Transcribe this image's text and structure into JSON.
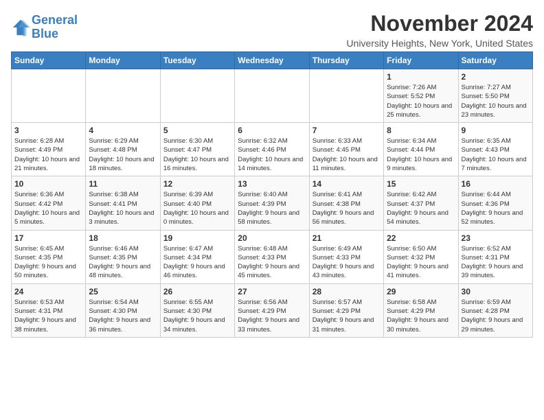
{
  "logo": {
    "line1": "General",
    "line2": "Blue"
  },
  "title": "November 2024",
  "subtitle": "University Heights, New York, United States",
  "days_header": [
    "Sunday",
    "Monday",
    "Tuesday",
    "Wednesday",
    "Thursday",
    "Friday",
    "Saturday"
  ],
  "weeks": [
    [
      {
        "day": "",
        "info": ""
      },
      {
        "day": "",
        "info": ""
      },
      {
        "day": "",
        "info": ""
      },
      {
        "day": "",
        "info": ""
      },
      {
        "day": "",
        "info": ""
      },
      {
        "day": "1",
        "info": "Sunrise: 7:26 AM\nSunset: 5:52 PM\nDaylight: 10 hours and 25 minutes."
      },
      {
        "day": "2",
        "info": "Sunrise: 7:27 AM\nSunset: 5:50 PM\nDaylight: 10 hours and 23 minutes."
      }
    ],
    [
      {
        "day": "3",
        "info": "Sunrise: 6:28 AM\nSunset: 4:49 PM\nDaylight: 10 hours and 21 minutes."
      },
      {
        "day": "4",
        "info": "Sunrise: 6:29 AM\nSunset: 4:48 PM\nDaylight: 10 hours and 18 minutes."
      },
      {
        "day": "5",
        "info": "Sunrise: 6:30 AM\nSunset: 4:47 PM\nDaylight: 10 hours and 16 minutes."
      },
      {
        "day": "6",
        "info": "Sunrise: 6:32 AM\nSunset: 4:46 PM\nDaylight: 10 hours and 14 minutes."
      },
      {
        "day": "7",
        "info": "Sunrise: 6:33 AM\nSunset: 4:45 PM\nDaylight: 10 hours and 11 minutes."
      },
      {
        "day": "8",
        "info": "Sunrise: 6:34 AM\nSunset: 4:44 PM\nDaylight: 10 hours and 9 minutes."
      },
      {
        "day": "9",
        "info": "Sunrise: 6:35 AM\nSunset: 4:43 PM\nDaylight: 10 hours and 7 minutes."
      }
    ],
    [
      {
        "day": "10",
        "info": "Sunrise: 6:36 AM\nSunset: 4:42 PM\nDaylight: 10 hours and 5 minutes."
      },
      {
        "day": "11",
        "info": "Sunrise: 6:38 AM\nSunset: 4:41 PM\nDaylight: 10 hours and 3 minutes."
      },
      {
        "day": "12",
        "info": "Sunrise: 6:39 AM\nSunset: 4:40 PM\nDaylight: 10 hours and 0 minutes."
      },
      {
        "day": "13",
        "info": "Sunrise: 6:40 AM\nSunset: 4:39 PM\nDaylight: 9 hours and 58 minutes."
      },
      {
        "day": "14",
        "info": "Sunrise: 6:41 AM\nSunset: 4:38 PM\nDaylight: 9 hours and 56 minutes."
      },
      {
        "day": "15",
        "info": "Sunrise: 6:42 AM\nSunset: 4:37 PM\nDaylight: 9 hours and 54 minutes."
      },
      {
        "day": "16",
        "info": "Sunrise: 6:44 AM\nSunset: 4:36 PM\nDaylight: 9 hours and 52 minutes."
      }
    ],
    [
      {
        "day": "17",
        "info": "Sunrise: 6:45 AM\nSunset: 4:35 PM\nDaylight: 9 hours and 50 minutes."
      },
      {
        "day": "18",
        "info": "Sunrise: 6:46 AM\nSunset: 4:35 PM\nDaylight: 9 hours and 48 minutes."
      },
      {
        "day": "19",
        "info": "Sunrise: 6:47 AM\nSunset: 4:34 PM\nDaylight: 9 hours and 46 minutes."
      },
      {
        "day": "20",
        "info": "Sunrise: 6:48 AM\nSunset: 4:33 PM\nDaylight: 9 hours and 45 minutes."
      },
      {
        "day": "21",
        "info": "Sunrise: 6:49 AM\nSunset: 4:33 PM\nDaylight: 9 hours and 43 minutes."
      },
      {
        "day": "22",
        "info": "Sunrise: 6:50 AM\nSunset: 4:32 PM\nDaylight: 9 hours and 41 minutes."
      },
      {
        "day": "23",
        "info": "Sunrise: 6:52 AM\nSunset: 4:31 PM\nDaylight: 9 hours and 39 minutes."
      }
    ],
    [
      {
        "day": "24",
        "info": "Sunrise: 6:53 AM\nSunset: 4:31 PM\nDaylight: 9 hours and 38 minutes."
      },
      {
        "day": "25",
        "info": "Sunrise: 6:54 AM\nSunset: 4:30 PM\nDaylight: 9 hours and 36 minutes."
      },
      {
        "day": "26",
        "info": "Sunrise: 6:55 AM\nSunset: 4:30 PM\nDaylight: 9 hours and 34 minutes."
      },
      {
        "day": "27",
        "info": "Sunrise: 6:56 AM\nSunset: 4:29 PM\nDaylight: 9 hours and 33 minutes."
      },
      {
        "day": "28",
        "info": "Sunrise: 6:57 AM\nSunset: 4:29 PM\nDaylight: 9 hours and 31 minutes."
      },
      {
        "day": "29",
        "info": "Sunrise: 6:58 AM\nSunset: 4:29 PM\nDaylight: 9 hours and 30 minutes."
      },
      {
        "day": "30",
        "info": "Sunrise: 6:59 AM\nSunset: 4:28 PM\nDaylight: 9 hours and 29 minutes."
      }
    ]
  ]
}
